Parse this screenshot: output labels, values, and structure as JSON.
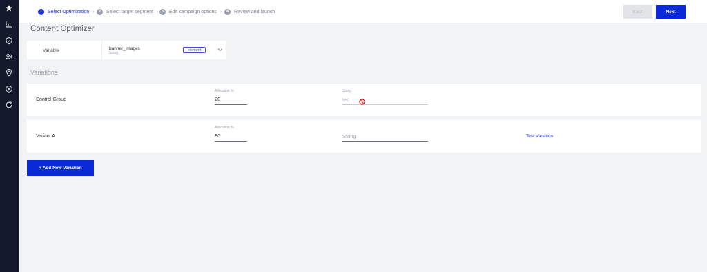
{
  "steps": [
    {
      "num": "1",
      "label": "Select Optimization"
    },
    {
      "num": "2",
      "label": "Select target segment"
    },
    {
      "num": "3",
      "label": "Edit campaign options"
    },
    {
      "num": "4",
      "label": "Review and launch"
    }
  ],
  "toolbar": {
    "back_label": "Back",
    "next_label": "Next"
  },
  "page": {
    "title": "Content Optimizer",
    "variations_title": "Variations"
  },
  "variable": {
    "label": "Variable",
    "name": "banner_images",
    "type": "String",
    "badge": "element"
  },
  "rows": [
    {
      "name": "Control Group",
      "allocation_label": "Allocation %",
      "allocation_value": "20",
      "string_label": "String",
      "string_value": "teo"
    },
    {
      "name": "Variant A",
      "allocation_label": "Allocation %",
      "allocation_value": "80",
      "string_placeholder": "String",
      "link": "Test Variation"
    }
  ],
  "add_button": "+ Add New Variation",
  "sidebar_icons": [
    "star-icon",
    "bar-chart-icon",
    "shield-icon",
    "users-icon",
    "location-pin-icon",
    "target-icon",
    "refresh-icon"
  ],
  "colors": {
    "sidebar": "#141a2b",
    "accent": "#0a2ad7",
    "background": "#f2f3f5"
  }
}
